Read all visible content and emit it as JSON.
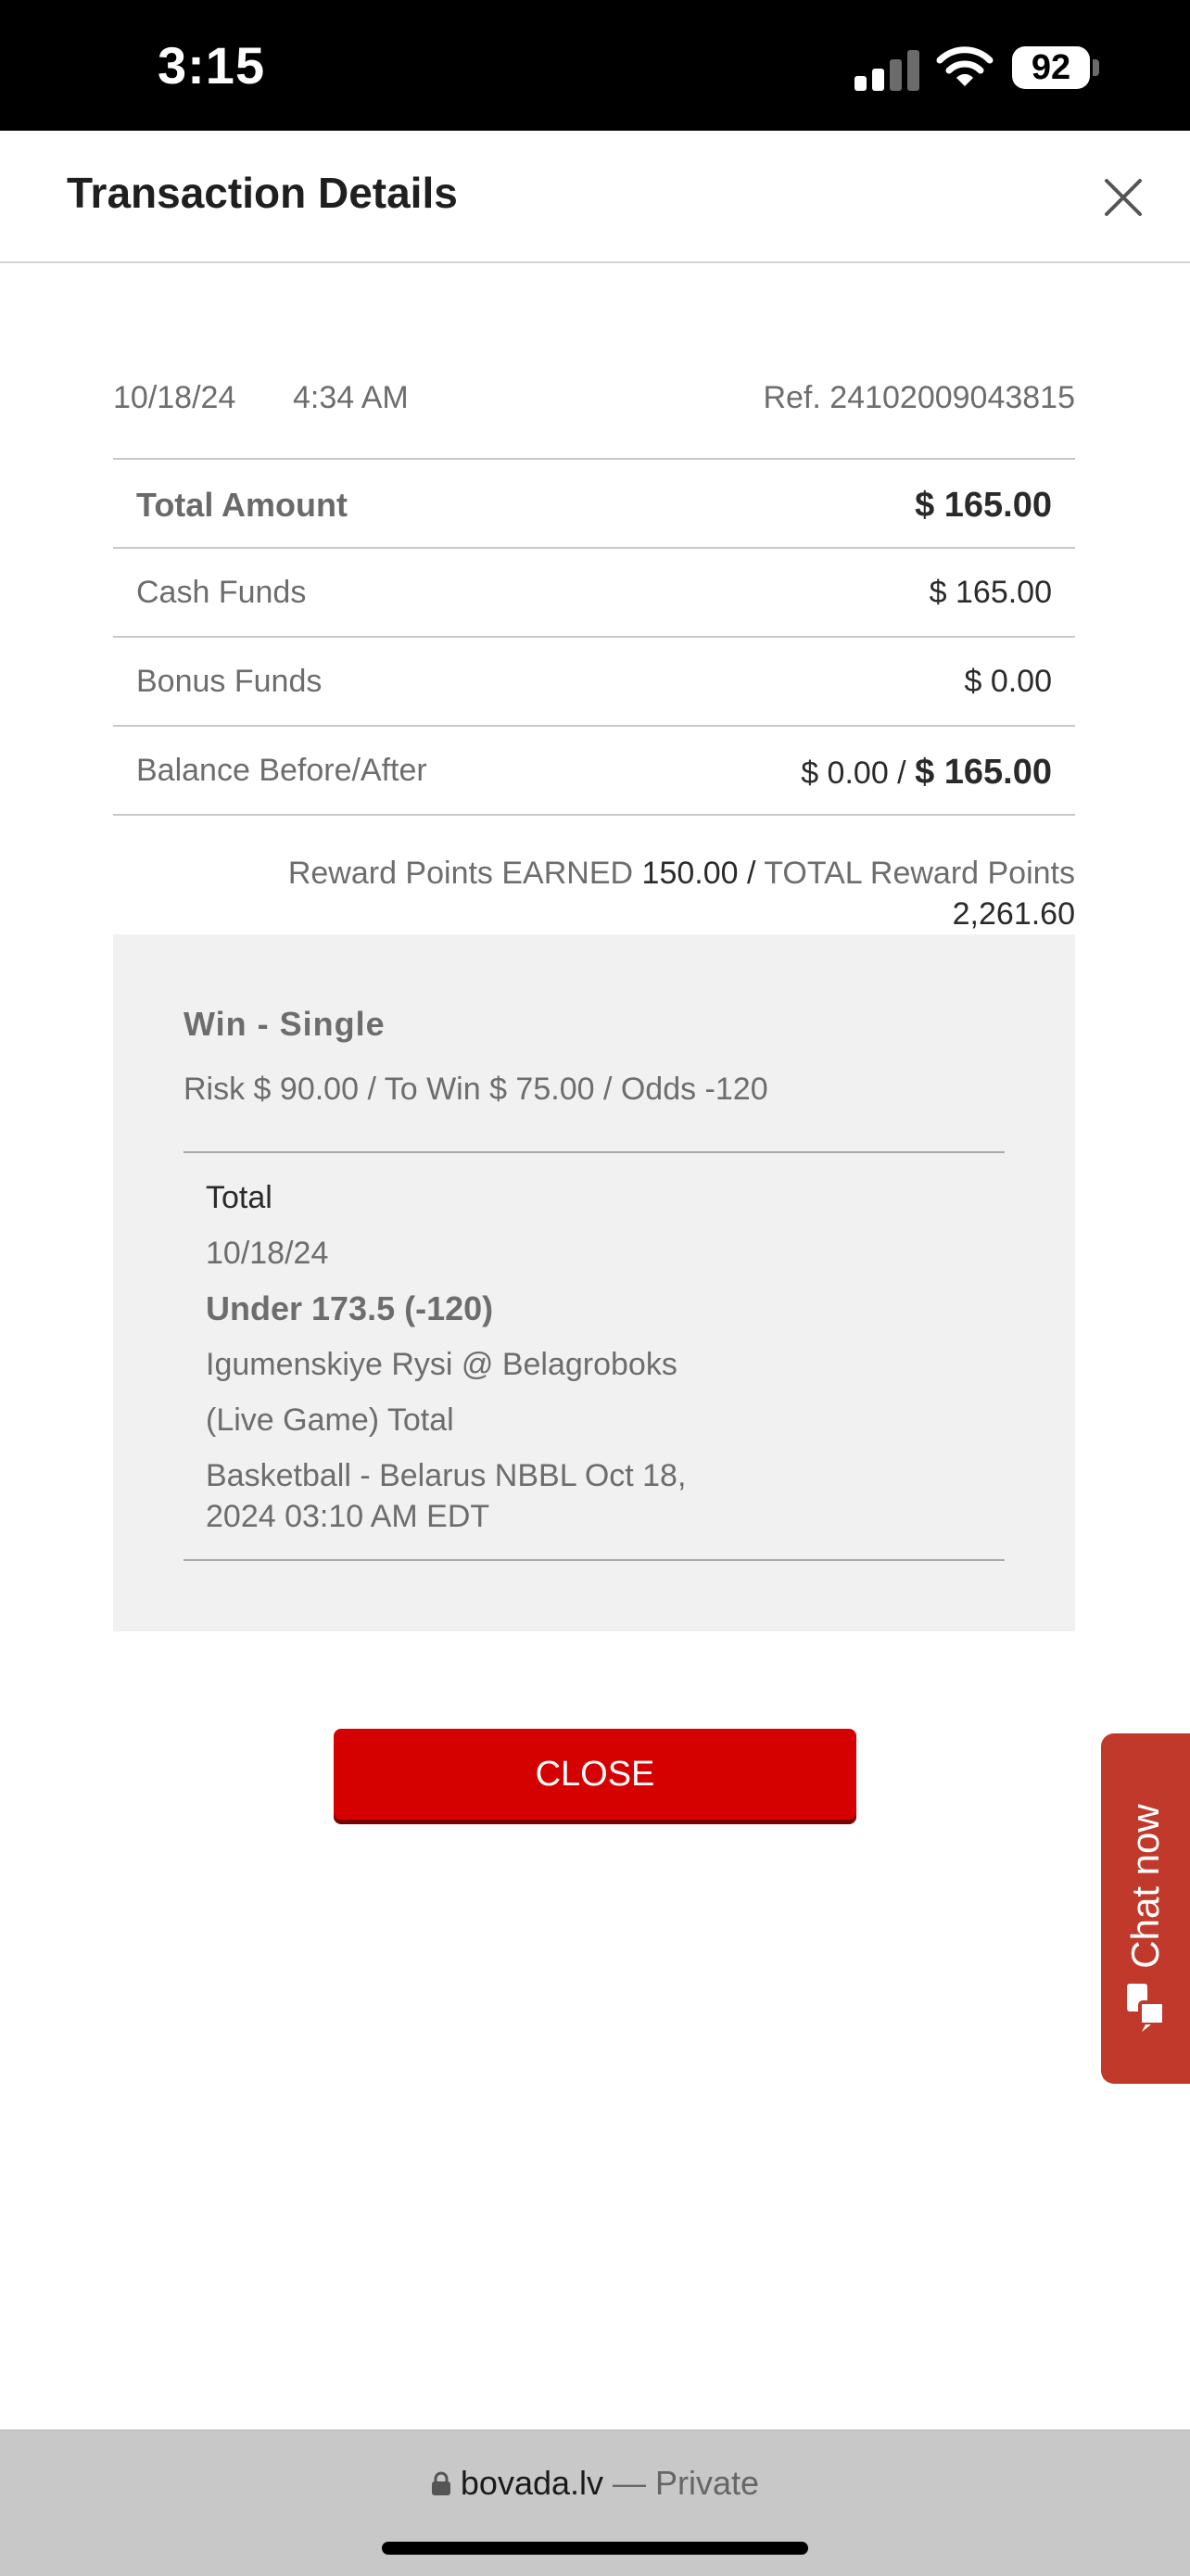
{
  "status_bar": {
    "time": "3:15",
    "battery": "92"
  },
  "header": {
    "title": "Transaction Details"
  },
  "transaction": {
    "date": "10/18/24",
    "time": "4:34 AM",
    "ref": "Ref. 24102009043815"
  },
  "summary": {
    "total_label": "Total Amount",
    "total_value": "$ 165.00",
    "cash_label": "Cash Funds",
    "cash_value": "$ 165.00",
    "bonus_label": "Bonus Funds",
    "bonus_value": "$ 0.00",
    "balance_label": "Balance Before/After",
    "balance_before": "$ 0.00 /",
    "balance_after": "$ 165.00"
  },
  "rewards": {
    "earned_label": "Reward Points EARNED",
    "earned_value": "150.00",
    "separator": "/",
    "total_label": "TOTAL Reward Points",
    "total_value": "2,261.60"
  },
  "bet": {
    "type": "Win - Single",
    "summary": "Risk $ 90.00 / To Win $ 75.00 / Odds -120",
    "leg": {
      "market": "Total",
      "date": "10/18/24",
      "selection": "Under 173.5 (-120)",
      "matchup": "Igumenskiye Rysi @ Belagroboks",
      "description": "(Live Game) Total",
      "event_line1": "Basketball - Belarus NBBL Oct 18,",
      "event_line2": "2024 03:10 AM EDT"
    }
  },
  "actions": {
    "close_label": "CLOSE"
  },
  "chat": {
    "label": "Chat now",
    "icon": "chat-bubbles-icon"
  },
  "browser": {
    "host": "bovada.lv",
    "private_label": "— Private"
  },
  "colors": {
    "accent": "#d50000",
    "chat": "#c0392b",
    "panel": "#f1f1f1"
  }
}
